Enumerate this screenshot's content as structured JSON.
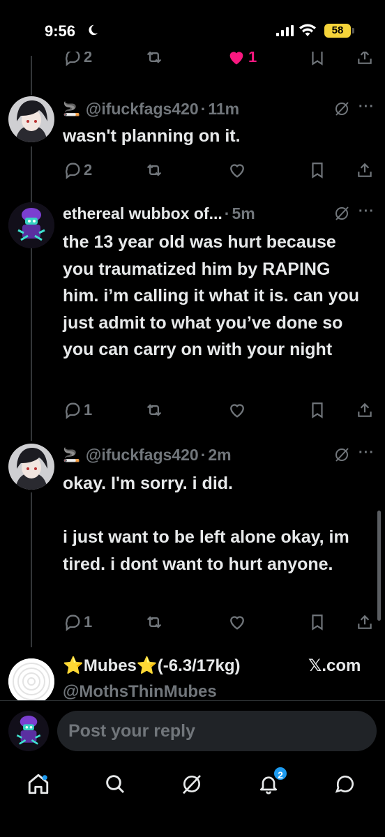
{
  "status_bar": {
    "time": "9:56",
    "battery": "58"
  },
  "top_row": {
    "reply_count": "2",
    "like_count": "1"
  },
  "tweets": [
    {
      "emoji": "🚬",
      "name": "",
      "handle": "@ifuckfags420",
      "dot": "·",
      "ago": "11m",
      "text": "wasn't planning on it.",
      "reply_count": "2"
    },
    {
      "emoji": "",
      "name": "ethereal wubbox of...",
      "handle": "",
      "dot": "·",
      "ago": "5m",
      "text": "the 13 year old was hurt because you traumatized him by RAPING him. i’m calling it what it is. can you just admit to what you’ve done so you can carry on with your night",
      "reply_count": "1"
    },
    {
      "emoji": "🚬",
      "name": "",
      "handle": "@ifuckfags420",
      "dot": "·",
      "ago": "2m",
      "text": "okay. I'm sorry. i did.\n\ni just want to be left alone okay, im tired. i dont want to hurt anyone.",
      "reply_count": "1"
    }
  ],
  "promo": {
    "name": "⭐Mubes⭐(-6.3/17kg)",
    "source": "𝕏.com",
    "handle": "@MothsThinMubes"
  },
  "composer": {
    "placeholder": "Post your reply"
  },
  "tabbar": {
    "notifications_badge": "2"
  },
  "colors": {
    "background": "#000000",
    "text": "#e7e9ea",
    "muted": "#71767b",
    "like": "#f91880",
    "accent": "#1d9bf0",
    "battery": "#f5d43a"
  },
  "icons": [
    "moon-icon",
    "signal-icon",
    "wifi-icon",
    "reply-icon",
    "retweet-icon",
    "heart-icon",
    "bookmark-icon",
    "share-icon",
    "grok-icon",
    "more-icon",
    "home-icon",
    "search-icon",
    "grok-tab-icon",
    "bell-icon",
    "messages-icon"
  ]
}
